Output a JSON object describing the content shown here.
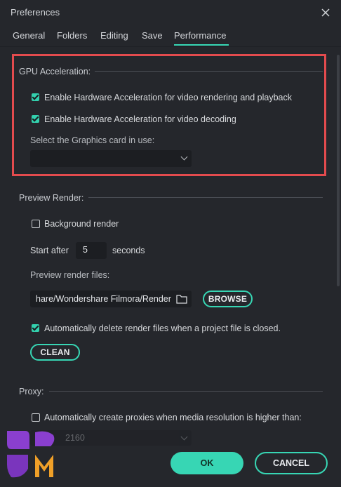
{
  "window": {
    "title": "Preferences"
  },
  "tabs": [
    {
      "label": "General"
    },
    {
      "label": "Folders"
    },
    {
      "label": "Editing"
    },
    {
      "label": "Save"
    },
    {
      "label": "Performance",
      "active": true
    }
  ],
  "gpu": {
    "heading": "GPU Acceleration:",
    "render_checkbox": {
      "label": "Enable Hardware Acceleration for video rendering and playback",
      "checked": true
    },
    "decode_checkbox": {
      "label": "Enable Hardware Acceleration for video decoding",
      "checked": true
    },
    "graphics_card_label": "Select the Graphics card in use:",
    "graphics_card_value": ""
  },
  "preview_render": {
    "heading": "Preview Render:",
    "background_render": {
      "label": "Background render",
      "checked": false
    },
    "start_after_label": "Start after",
    "start_after_value": "5",
    "seconds_label": "seconds",
    "files_label": "Preview render files:",
    "files_path": "hare/Wondershare Filmora/Render",
    "browse_label": "BROWSE",
    "auto_delete": {
      "label": "Automatically delete render files when a project file is closed.",
      "checked": true
    },
    "clean_label": "CLEAN"
  },
  "proxy": {
    "heading": "Proxy:",
    "auto_proxy": {
      "label": "Automatically create proxies when media resolution is higher than:",
      "checked": false
    },
    "resolution_value": "2160"
  },
  "footer": {
    "ok_label": "OK",
    "cancel_label": "CANCEL"
  },
  "colors": {
    "accent": "#37d6b4",
    "highlight": "#e34b4e",
    "background": "#25272c"
  },
  "icons": {
    "close": "close-icon",
    "folder": "folder-icon",
    "chevron": "chevron-down-icon"
  }
}
